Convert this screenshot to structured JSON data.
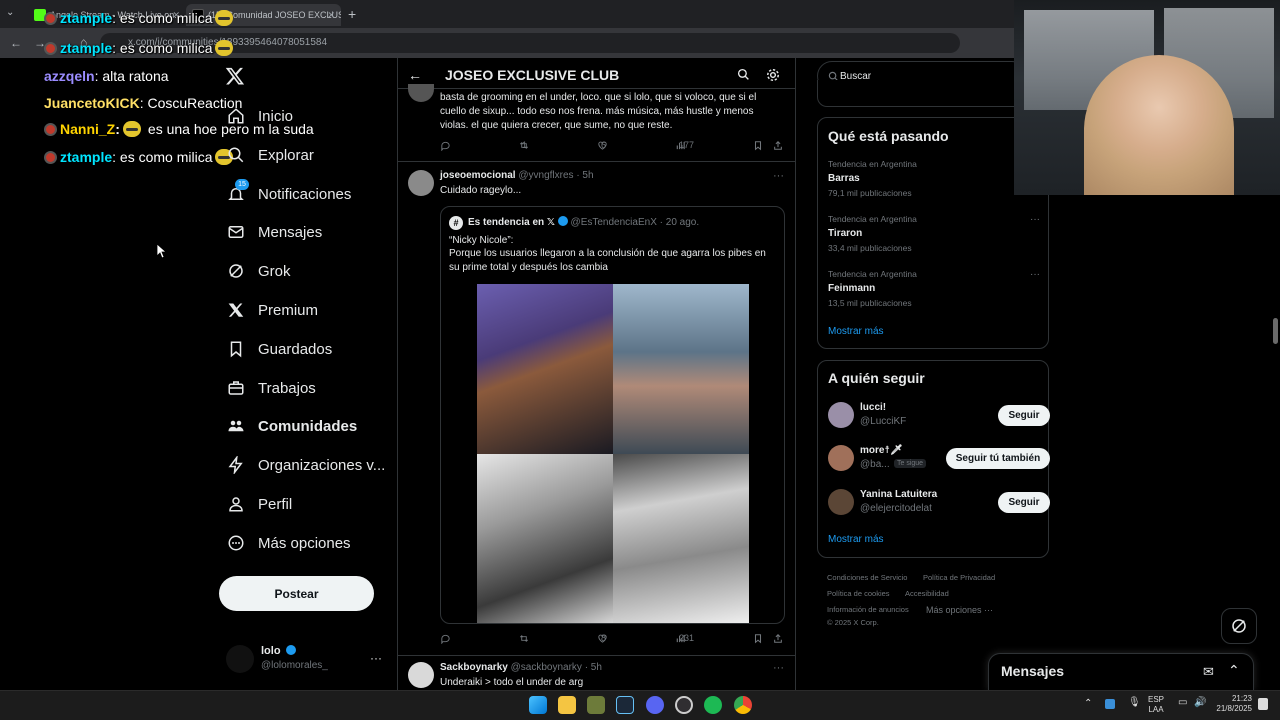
{
  "browser": {
    "tabs": [
      {
        "label": "Angelo Stream - Watch Live on..."
      },
      {
        "label": "(15) Comunidad JOSEO EXCLUS..."
      }
    ],
    "url": "x.com/i/communities/1893395464078051584"
  },
  "chat": [
    {
      "user": "ztample",
      "msg": ": es como milica",
      "color": "#00e5ff",
      "badge": true,
      "emote": true
    },
    {
      "user": "ztample",
      "msg": ": es como milica",
      "color": "#00e5ff",
      "badge": true,
      "emote": true
    },
    {
      "user": "azzqeln",
      "msg": ": alta ratona",
      "color": "#9b8cff",
      "badge": false,
      "emote": false
    },
    {
      "user": "JuancetoKICK",
      "msg": ": CoscuReaction",
      "color": "#ffe066",
      "badge": false,
      "emote": false
    },
    {
      "user": "Nanni_Z",
      "msg": "es una hoe pero m la suda",
      "color": "#ffd400",
      "badge": true,
      "emote": true
    },
    {
      "user": "ztample",
      "msg": ": es como milica",
      "color": "#00e5ff",
      "badge": true,
      "emote": true
    }
  ],
  "nav": {
    "items": [
      {
        "label": "Inicio"
      },
      {
        "label": "Explorar"
      },
      {
        "label": "Notificaciones",
        "badge": "15"
      },
      {
        "label": "Mensajes"
      },
      {
        "label": "Grok"
      },
      {
        "label": "Premium"
      },
      {
        "label": "Guardados"
      },
      {
        "label": "Trabajos"
      },
      {
        "label": "Comunidades"
      },
      {
        "label": "Organizaciones v..."
      },
      {
        "label": "Perfil"
      },
      {
        "label": "Más opciones"
      }
    ],
    "post_label": "Postear",
    "account": {
      "name": "lolo",
      "handle": "@lolomorales_"
    }
  },
  "header": {
    "title": "JOSEO EXCLUSIVE CLUB"
  },
  "posts": [
    {
      "text": "basta de grooming en el under, loco. que si lolo, que si voloco, que si el cuello de sixup... todo eso nos frena. más música, más hustle y menos violas. el que quiera crecer, que sume, no que reste.",
      "replies": "",
      "reposts": "1",
      "likes": "6",
      "views": "177"
    },
    {
      "name": "joseoemocional",
      "handle": "@yvngflxres",
      "time": "· 5h",
      "text": "Cuidado rageylo...",
      "quote": {
        "name": "Es tendencia en 𝕏",
        "handle": "@EsTendenciaEnX",
        "time": "· 20 ago.",
        "title": "“Nicky Nicole”:",
        "text": "Porque los usuarios llegaron a la conclusión de que agarra los pibes en su prime total y después los cambia"
      },
      "replies": "",
      "reposts": "",
      "likes": "8",
      "views": "231"
    },
    {
      "name": "Sackboynarky",
      "handle": "@sackboynarky",
      "time": "· 5h",
      "text": "Underaiki > todo el under de arg"
    }
  ],
  "search": {
    "placeholder": "Buscar"
  },
  "trends": {
    "title": "Qué está pasando",
    "items": [
      {
        "meta": "Tendencia en Argentina",
        "name": "Barras",
        "count": "79,1 mil publicaciones"
      },
      {
        "meta": "Tendencia en Argentina",
        "name": "Tiraron",
        "count": "33,4 mil publicaciones"
      },
      {
        "meta": "Tendencia en Argentina",
        "name": "Feinmann",
        "count": "13,5 mil publicaciones"
      }
    ],
    "more": "Mostrar más"
  },
  "follow": {
    "title": "A quién seguir",
    "items": [
      {
        "name": "lucci!",
        "handle": "@LucciKF",
        "button": "Seguir",
        "follows_you": ""
      },
      {
        "name": "more☨🗡",
        "handle": "@ba...",
        "button": "Seguir tú también",
        "follows_you": "Te sigue"
      },
      {
        "name": "Yanina Latuitera",
        "handle": "@elejercitodelat",
        "button": "Seguir",
        "follows_you": ""
      }
    ],
    "more": "Mostrar más"
  },
  "footer": {
    "links": [
      "Condiciones de Servicio",
      "Política de Privacidad",
      "Política de cookies",
      "Accesibilidad",
      "Información de anuncios",
      "Más opciones ···"
    ],
    "copyright": "© 2025 X Corp."
  },
  "messages_drawer": {
    "title": "Mensajes"
  },
  "taskbar": {
    "lang": "ESP",
    "lang2": "LAA",
    "time": "21:23",
    "date": "21/8/2025"
  }
}
